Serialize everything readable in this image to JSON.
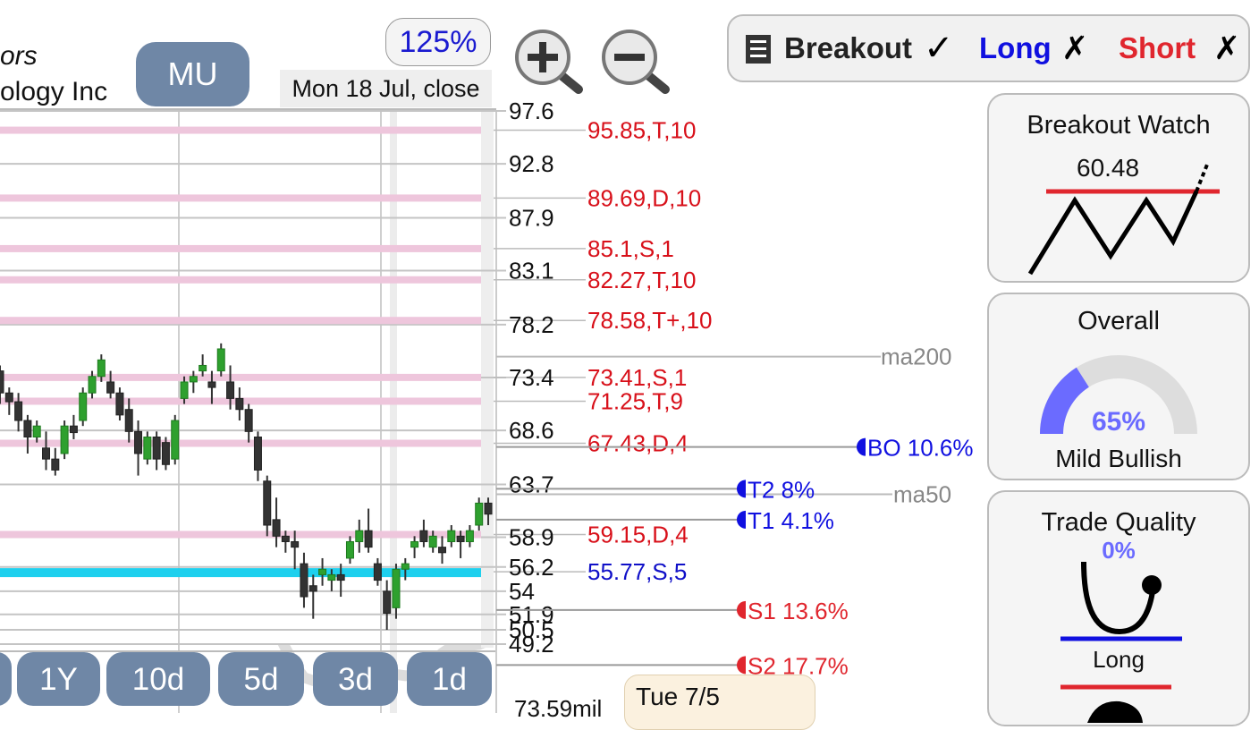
{
  "company": {
    "line1": "ors",
    "line2": "ology Inc"
  },
  "ticker": "MU",
  "zoom": "125%",
  "date_label": "Mon 18 Jul, close",
  "signals": {
    "breakout": {
      "label": "Breakout",
      "mark": "✓"
    },
    "long": {
      "label": "Long",
      "mark": "✗",
      "color": "#1010e0"
    },
    "short": {
      "label": "Short",
      "mark": "✗",
      "color": "#e0262e"
    }
  },
  "cards": {
    "breakout_watch": {
      "title": "Breakout Watch",
      "value": "60.48"
    },
    "overall": {
      "title": "Overall",
      "percent": "65%",
      "fraction": 0.65,
      "label": "Mild Bullish",
      "accent": "#6b6bff"
    },
    "trade_quality": {
      "title": "Trade Quality",
      "percent": "0%",
      "label": "Long"
    }
  },
  "timeframes": [
    {
      "label": "1Y"
    },
    {
      "label": "10d"
    },
    {
      "label": "5d"
    },
    {
      "label": "3d"
    },
    {
      "label": "1d"
    }
  ],
  "popup": "Tue 7/5",
  "volume_label": "73.59mil",
  "chart_data": {
    "type": "candlestick",
    "y_axis": {
      "min": 49.2,
      "max": 97.6,
      "ticks": [
        97.6,
        92.8,
        87.9,
        83.1,
        78.2,
        73.4,
        68.6,
        63.7,
        58.9,
        56.2,
        54,
        51.9,
        50.5,
        49.2
      ]
    },
    "levels": [
      {
        "price": 95.85,
        "label": "95.85,T,10",
        "kind": "resistance"
      },
      {
        "price": 89.69,
        "label": "89.69,D,10",
        "kind": "resistance"
      },
      {
        "price": 85.1,
        "label": "85.1,S,1",
        "kind": "resistance"
      },
      {
        "price": 82.27,
        "label": "82.27,T,10",
        "kind": "resistance"
      },
      {
        "price": 78.58,
        "label": "78.58,T+,10",
        "kind": "resistance"
      },
      {
        "price": 73.41,
        "label": "73.41,S,1",
        "kind": "resistance"
      },
      {
        "price": 71.25,
        "label": "71.25,T,9",
        "kind": "resistance"
      },
      {
        "price": 67.43,
        "label": "67.43,D,4",
        "kind": "resistance"
      },
      {
        "price": 59.15,
        "label": "59.15,D,4",
        "kind": "resistance"
      },
      {
        "price": 55.77,
        "label": "55.77,S,5",
        "kind": "support"
      }
    ],
    "markers": [
      {
        "price": 67.1,
        "label": "BO 10.6%",
        "color": "#1010e0"
      },
      {
        "price": 63.3,
        "label": "T2 8%",
        "color": "#1010e0"
      },
      {
        "price": 60.5,
        "label": "T1 4.1%",
        "color": "#1010e0"
      },
      {
        "price": 52.3,
        "label": "S1 13.6%",
        "color": "#e0262e"
      },
      {
        "price": 47.3,
        "label": "S2 17.7%",
        "color": "#e0262e"
      }
    ],
    "moving_averages": [
      {
        "name": "ma200",
        "price": 75.3
      },
      {
        "name": "ma50",
        "price": 62.8
      }
    ],
    "candles": [
      [
        74.0,
        74.5,
        71.0,
        72.0
      ],
      [
        72.0,
        72.5,
        70.0,
        71.2
      ],
      [
        71.2,
        72.0,
        68.5,
        69.5
      ],
      [
        69.5,
        70.0,
        66.5,
        68.0
      ],
      [
        68.0,
        69.5,
        67.5,
        69.0
      ],
      [
        67.0,
        68.5,
        65.0,
        66.0
      ],
      [
        66.0,
        67.0,
        64.5,
        65.0
      ],
      [
        66.5,
        69.5,
        66.0,
        69.0
      ],
      [
        69.0,
        70.0,
        67.8,
        68.4
      ],
      [
        69.5,
        72.5,
        69.0,
        72.0
      ],
      [
        72.0,
        74.0,
        71.5,
        73.5
      ],
      [
        73.5,
        75.5,
        73.0,
        75.0
      ],
      [
        73.0,
        74.0,
        71.5,
        72.0
      ],
      [
        72.0,
        72.5,
        69.5,
        70.0
      ],
      [
        70.5,
        71.5,
        67.5,
        68.5
      ],
      [
        68.5,
        69.5,
        64.5,
        66.5
      ],
      [
        66.0,
        68.5,
        65.5,
        68.0
      ],
      [
        68.0,
        68.5,
        65.0,
        66.0
      ],
      [
        67.5,
        68.0,
        65.0,
        65.5
      ],
      [
        66.0,
        70.0,
        65.5,
        69.5
      ],
      [
        71.5,
        73.5,
        71.0,
        73.0
      ],
      [
        73.0,
        74.0,
        72.0,
        73.5
      ],
      [
        74.0,
        75.5,
        73.5,
        74.5
      ],
      [
        73.0,
        74.0,
        71.0,
        72.5
      ],
      [
        74.0,
        76.5,
        73.5,
        76.0
      ],
      [
        73.0,
        74.5,
        70.5,
        71.5
      ],
      [
        71.5,
        72.5,
        69.5,
        70.5
      ],
      [
        70.5,
        71.0,
        67.5,
        68.5
      ],
      [
        68.0,
        68.5,
        64.0,
        65.0
      ],
      [
        64.0,
        64.5,
        59.0,
        60.0
      ],
      [
        60.5,
        62.5,
        58.0,
        59.0
      ],
      [
        59.0,
        59.5,
        57.5,
        58.5
      ],
      [
        58.5,
        59.5,
        56.0,
        58.0
      ],
      [
        56.5,
        57.5,
        52.5,
        53.5
      ],
      [
        54.5,
        55.5,
        51.5,
        54.0
      ],
      [
        55.5,
        57.0,
        54.5,
        56.0
      ],
      [
        55.0,
        56.0,
        54.0,
        55.5
      ],
      [
        55.5,
        56.5,
        53.5,
        55.0
      ],
      [
        57.0,
        59.0,
        56.5,
        58.5
      ],
      [
        58.5,
        60.5,
        57.5,
        59.5
      ],
      [
        59.5,
        61.5,
        57.5,
        58.0
      ],
      [
        56.5,
        57.0,
        54.5,
        55.0
      ],
      [
        54.0,
        55.0,
        50.5,
        52.0
      ],
      [
        52.5,
        56.5,
        51.5,
        56.0
      ],
      [
        56.0,
        57.0,
        55.0,
        56.5
      ],
      [
        58.0,
        59.0,
        57.0,
        58.5
      ],
      [
        59.5,
        60.5,
        58.0,
        58.5
      ],
      [
        58.0,
        59.5,
        57.5,
        59.0
      ],
      [
        58.0,
        59.0,
        56.5,
        57.5
      ],
      [
        58.5,
        60.0,
        58.0,
        59.5
      ],
      [
        59.0,
        59.5,
        57.0,
        58.5
      ],
      [
        58.5,
        60.0,
        58.0,
        59.5
      ],
      [
        60.0,
        62.5,
        59.5,
        62.0
      ],
      [
        62.0,
        62.5,
        60.0,
        61.0
      ]
    ]
  }
}
